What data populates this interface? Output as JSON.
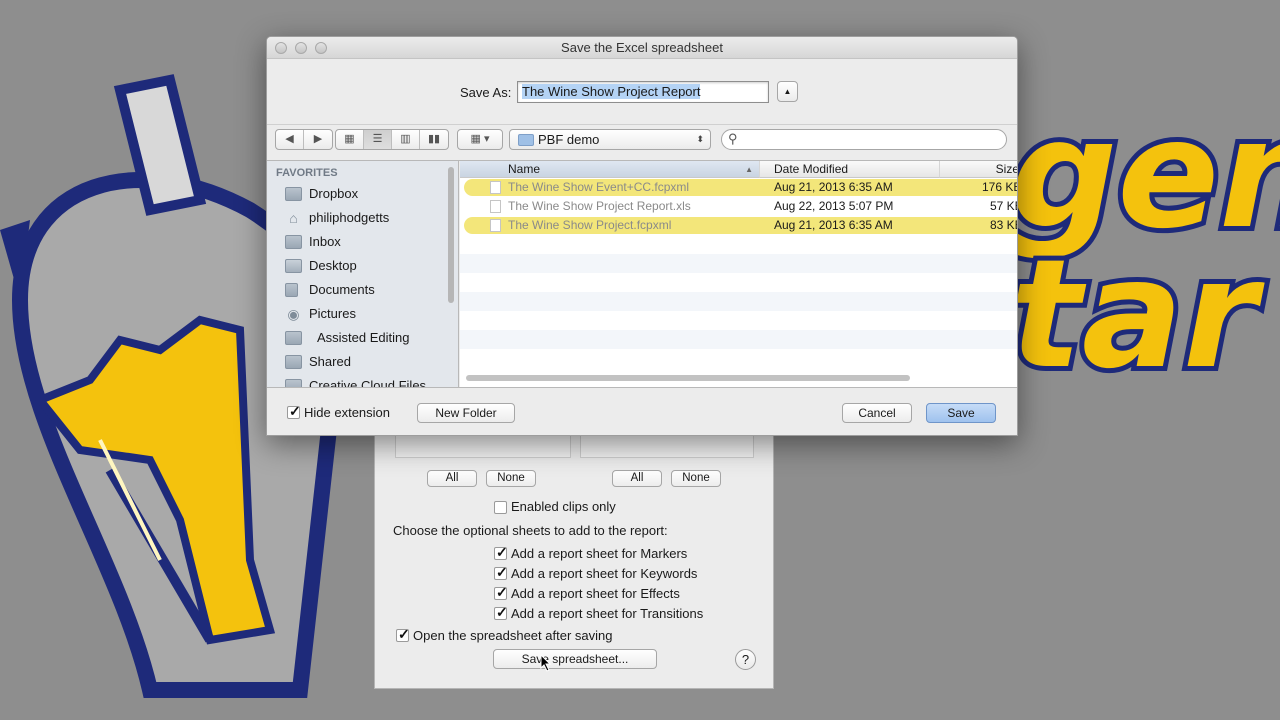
{
  "dialog": {
    "title": "Save the Excel spreadsheet",
    "save_as_label": "Save As:",
    "filename": "The Wine Show Project Report",
    "location": "PBF demo",
    "search_placeholder": "",
    "hide_extension_label": "Hide extension",
    "hide_extension_checked": true,
    "new_folder_label": "New Folder",
    "cancel_label": "Cancel",
    "save_label": "Save"
  },
  "sidebar": {
    "heading": "FAVORITES",
    "items": [
      {
        "label": "Dropbox",
        "icon": "folder-icon"
      },
      {
        "label": "philiphodgetts",
        "icon": "home-icon"
      },
      {
        "label": "Inbox",
        "icon": "folder-icon"
      },
      {
        "label": "Desktop",
        "icon": "desktop-icon"
      },
      {
        "label": "Documents",
        "icon": "documents-icon"
      },
      {
        "label": "Pictures",
        "icon": "camera-icon"
      },
      {
        "label": "Assisted Editing",
        "icon": "folder-icon"
      },
      {
        "label": "Shared",
        "icon": "folder-icon"
      },
      {
        "label": "Creative Cloud Files",
        "icon": "folder-icon"
      }
    ]
  },
  "file_list": {
    "columns": [
      "Name",
      "Date Modified",
      "Size"
    ],
    "rows": [
      {
        "name": "The Wine Show Event+CC.fcpxml",
        "date": "Aug 21, 2013 6:35 AM",
        "size": "176 KB",
        "highlighted": true
      },
      {
        "name": "The Wine Show Project Report.xls",
        "date": "Aug 22, 2013 5:07 PM",
        "size": "57 KB",
        "highlighted": false
      },
      {
        "name": "The Wine Show Project.fcpxml",
        "date": "Aug 21, 2013 6:35 AM",
        "size": "83 KB",
        "highlighted": true
      }
    ]
  },
  "report_panel": {
    "all_label": "All",
    "none_label": "None",
    "enabled_clips_label": "Enabled clips only",
    "enabled_clips_checked": false,
    "optional_sheets_prompt": "Choose the optional sheets to add to the report:",
    "sheets": [
      {
        "label": "Add a report sheet for Markers",
        "checked": true
      },
      {
        "label": "Add a report sheet for Keywords",
        "checked": true
      },
      {
        "label": "Add a report sheet for Effects",
        "checked": true
      },
      {
        "label": "Add a report sheet for Transitions",
        "checked": true
      }
    ],
    "open_after_label": "Open the spreadsheet after saving",
    "open_after_checked": true,
    "save_spreadsheet_label": "Save spreadsheet...",
    "help_label": "?"
  },
  "background": {
    "word1": "gen",
    "word2": "tar",
    "accent": "#f4c20d",
    "outline": "#1e2a7a"
  }
}
